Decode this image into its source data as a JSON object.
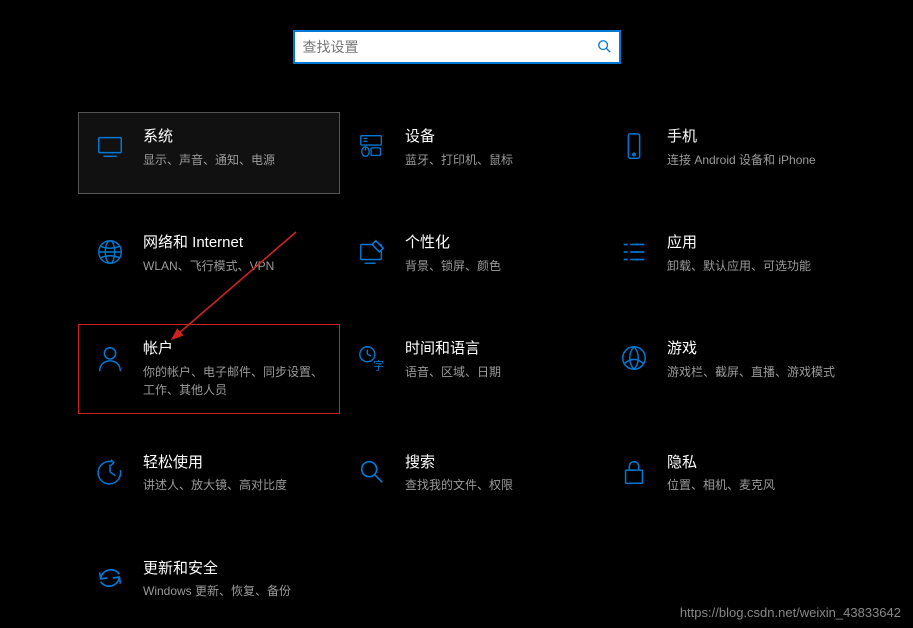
{
  "search": {
    "placeholder": "查找设置"
  },
  "tiles": {
    "system": {
      "title": "系统",
      "desc": "显示、声音、通知、电源"
    },
    "devices": {
      "title": "设备",
      "desc": "蓝牙、打印机、鼠标"
    },
    "phone": {
      "title": "手机",
      "desc": "连接 Android 设备和 iPhone"
    },
    "network": {
      "title": "网络和 Internet",
      "desc": "WLAN、飞行模式、VPN"
    },
    "personal": {
      "title": "个性化",
      "desc": "背景、锁屏、颜色"
    },
    "apps": {
      "title": "应用",
      "desc": "卸载、默认应用、可选功能"
    },
    "accounts": {
      "title": "帐户",
      "desc": "你的帐户、电子邮件、同步设置、工作、其他人员"
    },
    "time": {
      "title": "时间和语言",
      "desc": "语音、区域、日期"
    },
    "gaming": {
      "title": "游戏",
      "desc": "游戏栏、截屏、直播、游戏模式"
    },
    "ease": {
      "title": "轻松使用",
      "desc": "讲述人、放大镜、高对比度"
    },
    "search2": {
      "title": "搜索",
      "desc": "查找我的文件、权限"
    },
    "privacy": {
      "title": "隐私",
      "desc": "位置、相机、麦克风"
    },
    "update": {
      "title": "更新和安全",
      "desc": "Windows 更新、恢复、备份"
    }
  },
  "colors": {
    "accent": "#0078d4"
  },
  "watermark": "https://blog.csdn.net/weixin_43833642"
}
